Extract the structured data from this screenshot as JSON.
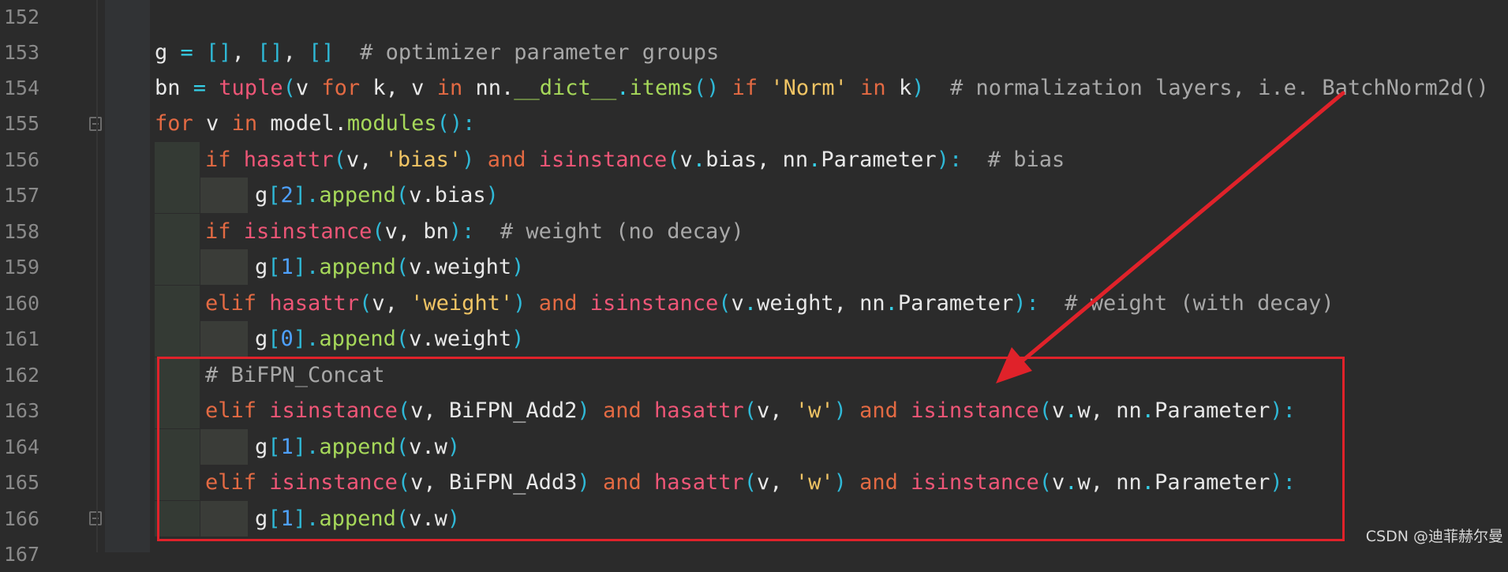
{
  "gutter": {
    "line_numbers": [
      "152",
      "153",
      "154",
      "155",
      "156",
      "157",
      "158",
      "159",
      "160",
      "161",
      "162",
      "163",
      "164",
      "165",
      "166",
      "167"
    ]
  },
  "code": {
    "l153": {
      "t1": "g",
      "t2": " = ",
      "t3": "[]",
      "t4": ", ",
      "t5": "[]",
      "t6": ", ",
      "t7": "[]",
      "t8": "  # optimizer parameter groups"
    },
    "l154": {
      "t1": "bn",
      "t2": " = ",
      "t3": "tuple",
      "t4": "(",
      "t5": "v ",
      "t6": "for",
      "t7": " k, v ",
      "t8": "in",
      "t9": " nn.",
      "t10": "__dict__",
      "t11": ".",
      "t12": "items",
      "t13": "()",
      "t14": " if ",
      "t15": "'Norm'",
      "t16": " in ",
      "t17": "k",
      "t18": ")",
      "t19": "  # normalization layers, i.e. BatchNorm2d()"
    },
    "l155": {
      "t1": "for",
      "t2": " v ",
      "t3": "in",
      "t4": " model.",
      "t5": "modules",
      "t6": "():"
    },
    "l156": {
      "t1": "if ",
      "t2": "hasattr",
      "t3": "(",
      "t4": "v, ",
      "t5": "'bias'",
      "t6": ")",
      "t7": " and ",
      "t8": "isinstance",
      "t9": "(",
      "t10": "v",
      "t11": ".",
      "t12": "bias, nn",
      "t13": ".",
      "t14": "Parameter",
      "t15": "):",
      "t16": "  # bias"
    },
    "l157": {
      "t1": "g",
      "t2": "[",
      "t3": "2",
      "t4": "].",
      "t5": "append",
      "t6": "(",
      "t7": "v.bias",
      "t8": ")"
    },
    "l158": {
      "t1": "if ",
      "t2": "isinstance",
      "t3": "(",
      "t4": "v, bn",
      "t5": "):",
      "t6": "  # weight (no decay)"
    },
    "l159": {
      "t1": "g",
      "t2": "[",
      "t3": "1",
      "t4": "].",
      "t5": "append",
      "t6": "(",
      "t7": "v.weight",
      "t8": ")"
    },
    "l160": {
      "t1": "elif ",
      "t2": "hasattr",
      "t3": "(",
      "t4": "v, ",
      "t5": "'weight'",
      "t6": ")",
      "t7": " and ",
      "t8": "isinstance",
      "t9": "(",
      "t10": "v",
      "t11": ".",
      "t12": "weight, nn",
      "t13": ".",
      "t14": "Parameter",
      "t15": "):",
      "t16": "  # weight (with decay)"
    },
    "l161": {
      "t1": "g",
      "t2": "[",
      "t3": "0",
      "t4": "].",
      "t5": "append",
      "t6": "(",
      "t7": "v.weight",
      "t8": ")"
    },
    "l162": {
      "t1": "# BiFPN_Concat"
    },
    "l163": {
      "t1": "elif ",
      "t2": "isinstance",
      "t3": "(",
      "t4": "v, BiFPN_Add2",
      "t5": ")",
      "t6": " and ",
      "t7": "hasattr",
      "t8": "(",
      "t9": "v, ",
      "t10": "'w'",
      "t11": ")",
      "t12": " and ",
      "t13": "isinstance",
      "t14": "(",
      "t15": "v",
      "t16": ".",
      "t17": "w, nn",
      "t18": ".",
      "t19": "Parameter",
      "t20": "):"
    },
    "l164": {
      "t1": "g",
      "t2": "[",
      "t3": "1",
      "t4": "].",
      "t5": "append",
      "t6": "(",
      "t7": "v.w",
      "t8": ")"
    },
    "l165": {
      "t1": "elif ",
      "t2": "isinstance",
      "t3": "(",
      "t4": "v, BiFPN_Add3",
      "t5": ")",
      "t6": " and ",
      "t7": "hasattr",
      "t8": "(",
      "t9": "v, ",
      "t10": "'w'",
      "t11": ")",
      "t12": " and ",
      "t13": "isinstance",
      "t14": "(",
      "t15": "v",
      "t16": ".",
      "t17": "w, nn",
      "t18": ".",
      "t19": "Parameter",
      "t20": "):"
    },
    "l166": {
      "t1": "g",
      "t2": "[",
      "t3": "1",
      "t4": "].",
      "t5": "append",
      "t6": "(",
      "t7": "v.w",
      "t8": ")"
    }
  },
  "annotation": {
    "box_color": "#e0222a",
    "arrow_color": "#e0222a"
  },
  "watermark": "CSDN @迪菲赫尔曼",
  "colors": {
    "background": "#2b2b2b",
    "keyword": "#e36a43",
    "builtin": "#ee5677",
    "string": "#f0c464",
    "comment": "#a8a8a8",
    "number": "#4ea1ff",
    "method": "#a6d85a"
  }
}
